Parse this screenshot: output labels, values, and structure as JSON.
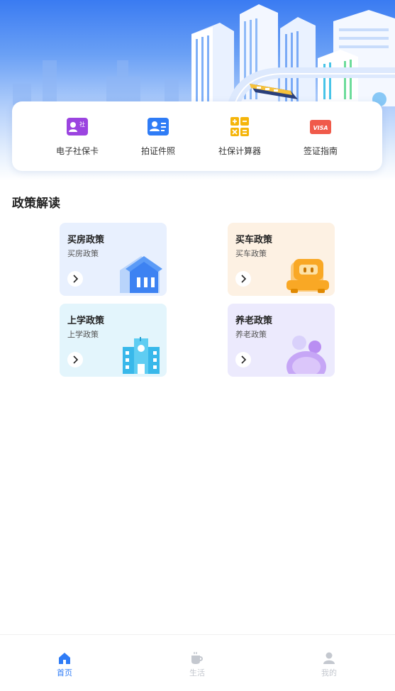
{
  "quick_actions": [
    {
      "label": "电子社保卡",
      "icon": "social-security-card-icon"
    },
    {
      "label": "拍证件照",
      "icon": "id-photo-icon"
    },
    {
      "label": "社保计算器",
      "icon": "calculator-icon"
    },
    {
      "label": "签证指南",
      "icon": "visa-icon"
    }
  ],
  "visa_badge_text": "VISA",
  "card_icon_text": "社",
  "section": {
    "title": "政策解读"
  },
  "policies": [
    {
      "title": "买房政策",
      "subtitle": "买房政策",
      "icon": "house-icon",
      "bg": "#e8f0fe"
    },
    {
      "title": "买车政策",
      "subtitle": "买车政策",
      "icon": "car-icon",
      "bg": "#fdf1e3"
    },
    {
      "title": "上学政策",
      "subtitle": "上学政策",
      "icon": "school-icon",
      "bg": "#e3f5fc"
    },
    {
      "title": "养老政策",
      "subtitle": "养老政策",
      "icon": "elderly-icon",
      "bg": "#eceafd"
    }
  ],
  "tabs": [
    {
      "label": "首页",
      "icon": "home-icon",
      "active": true
    },
    {
      "label": "生活",
      "icon": "cup-icon",
      "active": false
    },
    {
      "label": "我的",
      "icon": "user-icon",
      "active": false
    }
  ],
  "colors": {
    "primary": "#2f7cf6",
    "tab_active": "#2f7cf6",
    "tab_inactive": "#c4c8cf",
    "card_purple": "#9b44e0",
    "calculator_yellow": "#f5b50a",
    "visa_red": "#f05a4a"
  }
}
